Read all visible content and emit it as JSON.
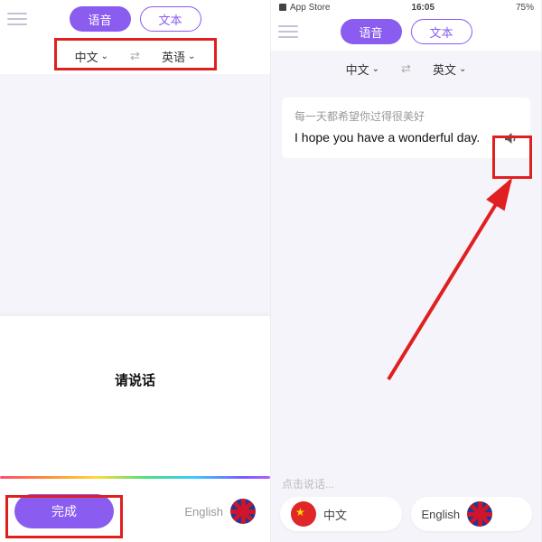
{
  "left": {
    "tabs": {
      "voice": "语音",
      "text": "文本"
    },
    "lang": {
      "from": "中文",
      "to": "英语"
    },
    "prompt": "请说话",
    "done": "完成",
    "english_label": "English"
  },
  "right": {
    "status": {
      "app_store": "App Store",
      "time": "16:05",
      "battery": "75%"
    },
    "tabs": {
      "voice": "语音",
      "text": "文本"
    },
    "lang": {
      "from": "中文",
      "to": "英文"
    },
    "card": {
      "source": "每一天都希望你过得很美好",
      "target": "I hope you have a wonderful day."
    },
    "placeholder": "点击说话...",
    "cn_label": "中文",
    "en_label": "English"
  }
}
